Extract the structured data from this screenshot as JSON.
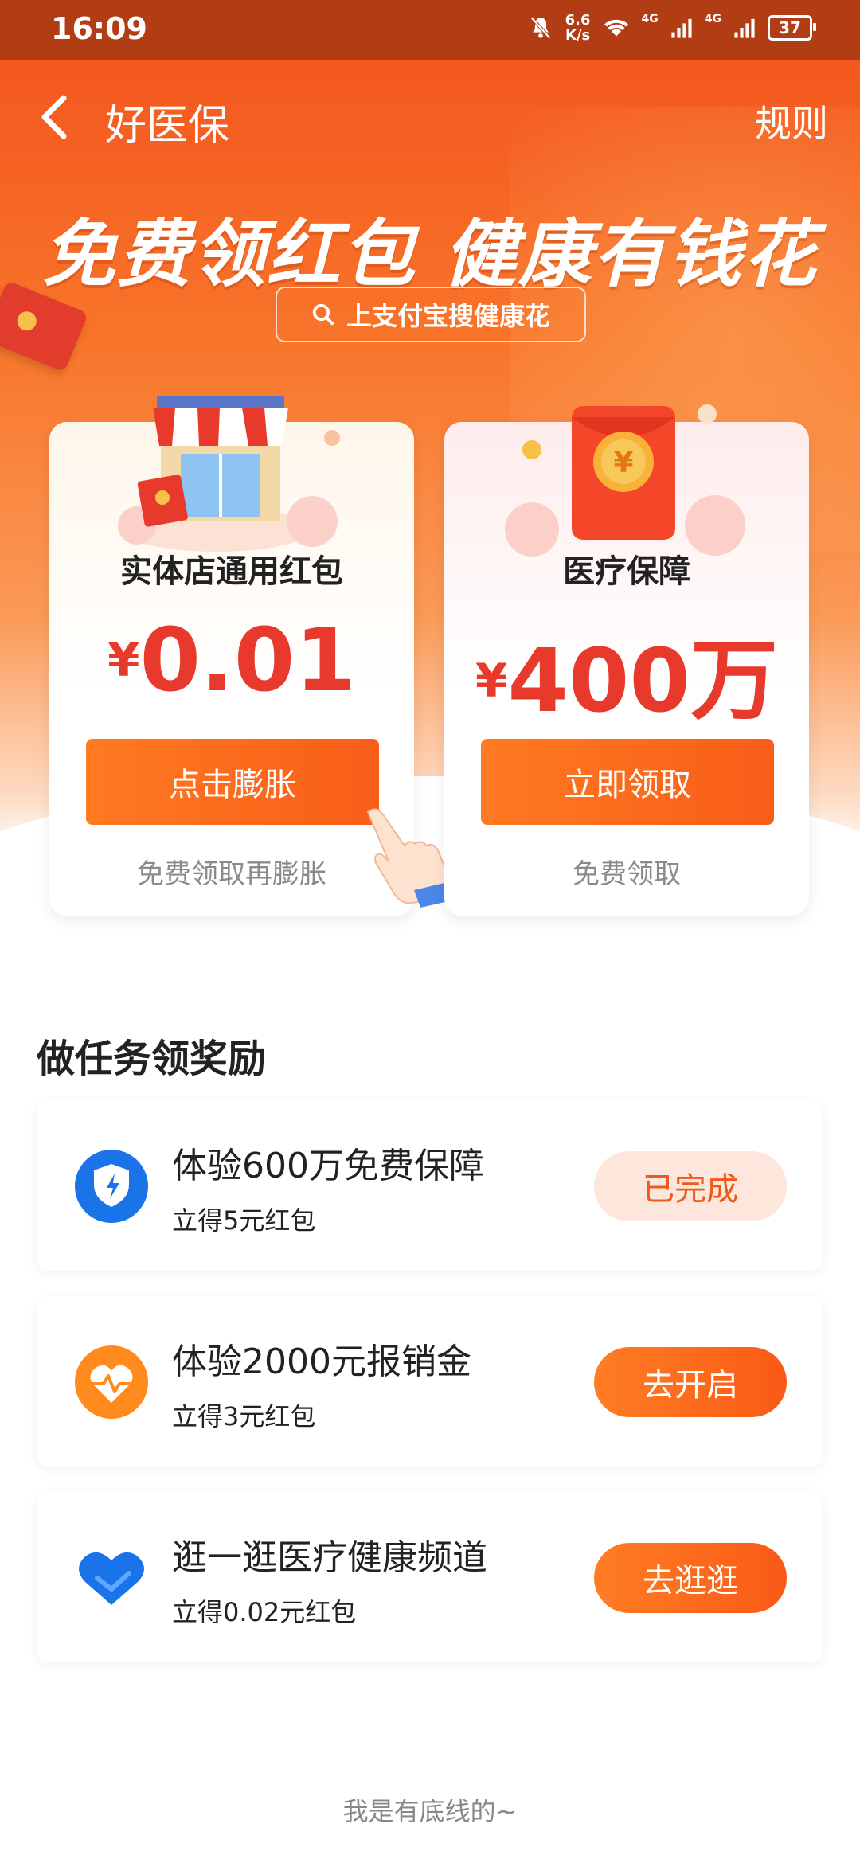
{
  "status_bar": {
    "time": "16:09",
    "speed": "6.6",
    "speed_unit": "K/s",
    "net1": "4G",
    "net2": "4G",
    "battery": "37"
  },
  "nav": {
    "title": "好医保",
    "rules_label": "规则"
  },
  "banner": {
    "slogan": "免费领红包  健康有钱花",
    "search_text": "上支付宝搜健康花"
  },
  "cards": [
    {
      "title": "实体店通用红包",
      "currency": "¥",
      "amount": "0.01",
      "button": "点击膨胀",
      "sub": "免费领取再膨胀"
    },
    {
      "title": "医疗保障",
      "currency": "¥",
      "amount": "400万",
      "button": "立即领取",
      "sub": "免费领取"
    }
  ],
  "tasks_section": {
    "heading": "做任务领奖励",
    "items": [
      {
        "title": "体验600万免费保障",
        "sub": "立得5元红包",
        "button": "已完成",
        "icon": "shield-bolt-icon",
        "state": "done"
      },
      {
        "title": "体验2000元报销金",
        "sub": "立得3元红包",
        "button": "去开启",
        "icon": "heart-pulse-icon",
        "state": "go"
      },
      {
        "title": "逛一逛医疗健康频道",
        "sub": "立得0.02元红包",
        "button": "去逛逛",
        "icon": "blue-heart-icon",
        "state": "go"
      }
    ]
  },
  "footer": {
    "text": "我是有底线的~"
  },
  "colors": {
    "brand_orange": "#f95d18",
    "amount_red": "#e8392d",
    "status_bar": "#b23d14",
    "done_bg": "#fde6dc"
  }
}
